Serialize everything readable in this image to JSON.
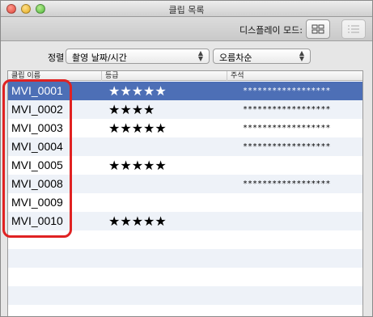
{
  "window": {
    "title": "클립 목록"
  },
  "toolbar": {
    "display_mode_label": "디스플레이 모드:"
  },
  "sort": {
    "label": "정렬",
    "field_value": "촬영 날짜/시간",
    "order_value": "오름차순"
  },
  "table": {
    "columns": [
      "클립 이름",
      "등급",
      "주석"
    ],
    "rows": [
      {
        "name": "MVI_0001",
        "rating": "★★★★★",
        "note": "******************",
        "selected": true
      },
      {
        "name": "MVI_0002",
        "rating": "★★★★",
        "note": "******************"
      },
      {
        "name": "MVI_0003",
        "rating": "★★★★★",
        "note": "******************"
      },
      {
        "name": "MVI_0004",
        "rating": "",
        "note": "******************"
      },
      {
        "name": "MVI_0005",
        "rating": "★★★★★",
        "note": ""
      },
      {
        "name": "MVI_0008",
        "rating": "",
        "note": "******************"
      },
      {
        "name": "MVI_0009",
        "rating": "",
        "note": ""
      },
      {
        "name": "MVI_0010",
        "rating": "★★★★★",
        "note": ""
      },
      {
        "name": "",
        "rating": "",
        "note": ""
      },
      {
        "name": "",
        "rating": "",
        "note": ""
      },
      {
        "name": "",
        "rating": "",
        "note": ""
      },
      {
        "name": "",
        "rating": "",
        "note": ""
      },
      {
        "name": "",
        "rating": "",
        "note": ""
      }
    ]
  },
  "colors": {
    "selection": "#4d6fb6",
    "highlight_outline": "#e02222",
    "stripe": "#eef2f8"
  },
  "icons": {
    "grid_view": "grid-view-icon",
    "list_view": "list-view-icon"
  }
}
